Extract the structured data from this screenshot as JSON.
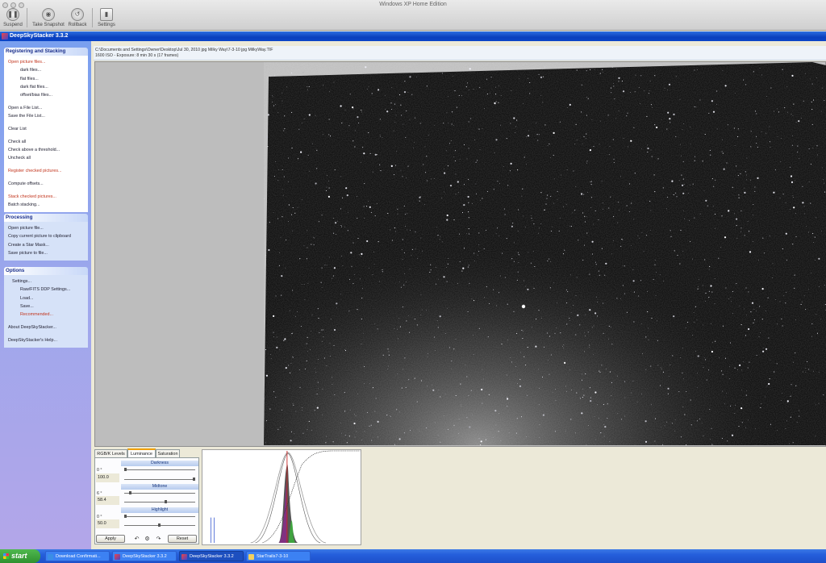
{
  "host": {
    "title": "Windows XP Home Edition",
    "toolbar": [
      {
        "label": "Suspend",
        "icon": "pause-icon"
      },
      {
        "label": "Take Snapshot",
        "icon": "camera-icon"
      },
      {
        "label": "Rollback",
        "icon": "rollback-icon"
      },
      {
        "label": "Settings",
        "icon": "switch-icon"
      }
    ]
  },
  "window": {
    "title": "DeepSkyStacker 3.3.2"
  },
  "sidebar": {
    "registering": {
      "title": "Registering and Stacking",
      "items": [
        {
          "label": "Open picture files...",
          "style": "red"
        },
        {
          "label": "dark files...",
          "style": "indent"
        },
        {
          "label": "flat files...",
          "style": "indent"
        },
        {
          "label": "dark flat files...",
          "style": "indent"
        },
        {
          "label": "offset/bias files...",
          "style": "indent"
        },
        {
          "label": "Open a File List...",
          "style": "plain"
        },
        {
          "label": "Save the File List...",
          "style": "plain"
        },
        {
          "label": "Clear List",
          "style": "plain"
        },
        {
          "label": "Check all",
          "style": "plain"
        },
        {
          "label": "Check above a threshold...",
          "style": "plain"
        },
        {
          "label": "Uncheck all",
          "style": "plain"
        },
        {
          "label": "Register checked pictures...",
          "style": "red"
        },
        {
          "label": "Compute offsets...",
          "style": "plain"
        },
        {
          "label": "Stack checked pictures...",
          "style": "red"
        },
        {
          "label": "Batch stacking...",
          "style": "plain"
        }
      ]
    },
    "processing": {
      "title": "Processing",
      "items": [
        {
          "label": "Open picture file..."
        },
        {
          "label": "Copy current picture to clipboard"
        },
        {
          "label": "Create a Star Mask..."
        },
        {
          "label": "Save picture to file..."
        }
      ]
    },
    "options": {
      "title": "Options",
      "items": [
        {
          "label": "Settings...",
          "style": "indent1"
        },
        {
          "label": "Raw/FITS DDP Settings...",
          "style": "indent"
        },
        {
          "label": "Load...",
          "style": "indent"
        },
        {
          "label": "Save...",
          "style": "indent"
        },
        {
          "label": "Recommended...",
          "style": "indent-red"
        },
        {
          "label": "About DeepSkyStacker...",
          "style": "plain"
        },
        {
          "label": "DeepSkyStacker's Help...",
          "style": "plain"
        }
      ]
    }
  },
  "file": {
    "path": "C:\\Documents and Settings\\Owner\\Desktop\\Jul 30, 2010 jpg Milky Way\\7-3-10 jpg MilkyWay.TIF",
    "info": "1600 ISO - Exposure: 8 min 30 s (17 frames)"
  },
  "adjust": {
    "tabs": [
      "RGB/K Levels",
      "Luminance",
      "Saturation"
    ],
    "active_tab": "Luminance",
    "darkness": {
      "title": "Darkness",
      "angle": "0 °",
      "value": "100.0"
    },
    "midtone": {
      "title": "Midtone",
      "angle": "6 °",
      "value": "58.4"
    },
    "highlight": {
      "title": "Highlight",
      "angle": "0 °",
      "value": "50.0"
    },
    "apply_label": "Apply",
    "reset_label": "Reset"
  },
  "taskbar": {
    "start_label": "start",
    "tasks": [
      {
        "label": "Download Confirmati...",
        "active": false
      },
      {
        "label": "DeepSkyStacker 3.3.2",
        "active": false
      },
      {
        "label": "DeepSkyStacker 3.3.2",
        "active": true
      },
      {
        "label": "StarTrails7-3-10",
        "active": false
      }
    ]
  },
  "colors": {
    "xp_title_blue": "#0a3fbd",
    "taskbar_blue": "#245edb",
    "start_green": "#2f912f",
    "menu_red": "#c2341c"
  }
}
